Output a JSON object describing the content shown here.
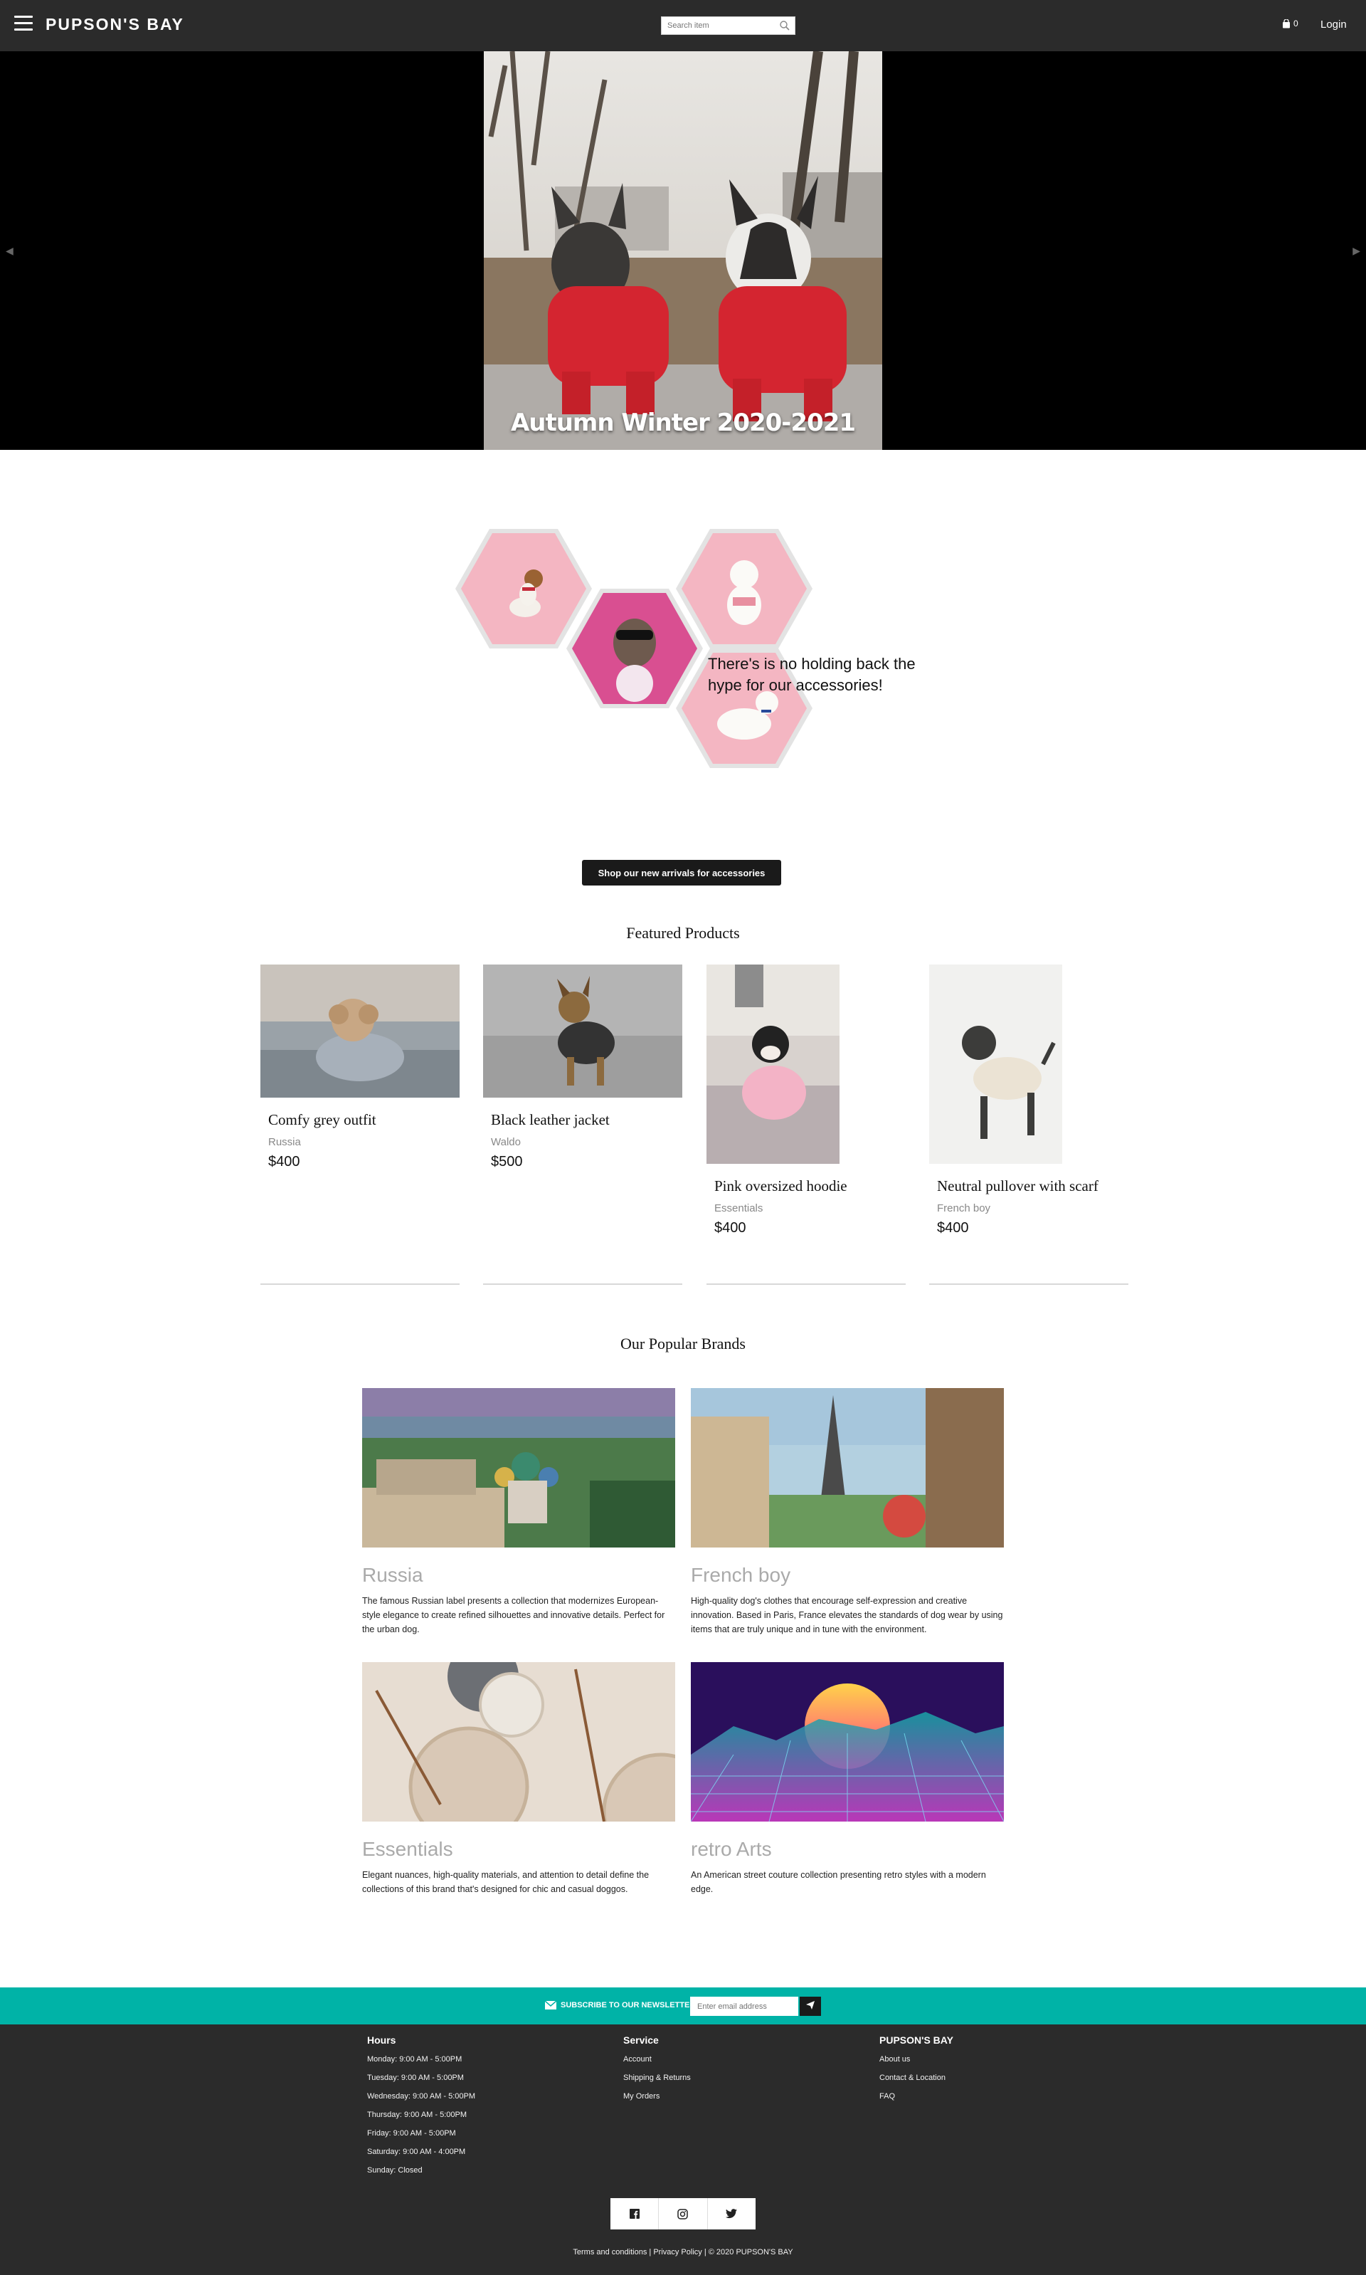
{
  "nav": {
    "brand": "PUPSON'S BAY",
    "search_placeholder": "Search item",
    "cart_count": "0",
    "login": "Login"
  },
  "hero": {
    "caption": "Autumn Winter 2020-2021"
  },
  "accessories": {
    "text": "There's is no holding back the hype for our accessories!",
    "cta": "Shop our new arrivals for accessories"
  },
  "featured": {
    "title": "Featured Products",
    "products": [
      {
        "name": "Comfy grey outfit",
        "brand": "Russia",
        "price": "$400"
      },
      {
        "name": "Black leather jacket",
        "brand": "Waldo",
        "price": "$500"
      },
      {
        "name": "Pink oversized hoodie",
        "brand": "Essentials",
        "price": "$400"
      },
      {
        "name": "Neutral pullover with scarf",
        "brand": "French boy",
        "price": "$400"
      }
    ]
  },
  "brands": {
    "title": "Our Popular Brands",
    "items": [
      {
        "name": "Russia",
        "desc": "The famous Russian label presents a collection that modernizes European-style elegance to create refined silhouettes and innovative details. Perfect for the urban dog."
      },
      {
        "name": "French boy",
        "desc": "High-quality dog's clothes that encourage self-expression and creative innovation. Based in Paris, France elevates the standards of dog wear by using items that are truly unique and in tune with the environment."
      },
      {
        "name": "Essentials",
        "desc": "Elegant nuances, high-quality materials, and attention to detail define the collections of this brand that's designed for chic and casual doggos."
      },
      {
        "name": "retro Arts",
        "desc": "An American street couture collection presenting retro styles with a modern edge."
      }
    ]
  },
  "newsletter": {
    "label": "SUBSCRIBE TO OUR NEWSLETTER",
    "placeholder": "Enter email address"
  },
  "footer": {
    "hours": {
      "title": "Hours",
      "items": [
        "Monday: 9:00 AM - 5:00PM",
        "Tuesday: 9:00 AM - 5:00PM",
        "Wednesday: 9:00 AM - 5:00PM",
        "Thursday: 9:00 AM - 5:00PM",
        "Friday: 9:00 AM - 5:00PM",
        "Saturday: 9:00 AM - 4:00PM",
        "Sunday: Closed"
      ]
    },
    "service": {
      "title": "Service",
      "items": [
        "Account",
        "Shipping & Returns",
        "My Orders"
      ]
    },
    "company": {
      "title": "PUPSON'S BAY",
      "items": [
        "About us",
        "Contact & Location",
        "FAQ"
      ]
    },
    "legal": {
      "terms": "Terms and conditions",
      "privacy": "Privacy Policy",
      "copyright": "© 2020 PUPSON'S BAY",
      "sep": "|"
    }
  },
  "colors": {
    "nav_bg": "#2b2b2b",
    "newsletter_bg": "#00b3a7",
    "footer_bg": "#2b2b2b",
    "hex_pink": "#f4b6c2"
  }
}
